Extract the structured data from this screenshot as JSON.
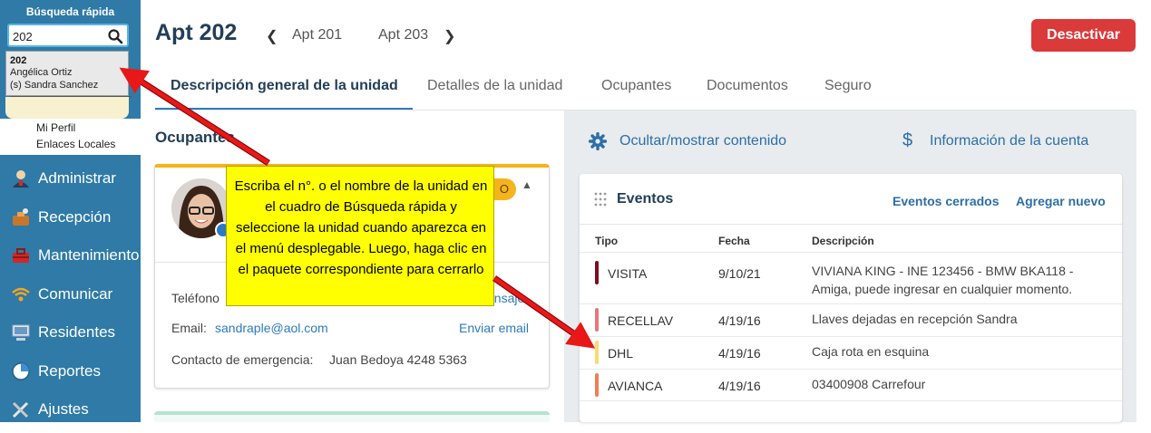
{
  "quick_search": {
    "title": "Búsqueda rápida",
    "value": "202",
    "dropdown": {
      "unit": "202",
      "line1": "Angélica Ortiz",
      "line2": "(s) Sandra Sanchez"
    }
  },
  "submenu": [
    "Mi Perfil",
    "Enlaces Locales"
  ],
  "nav": [
    {
      "label": "Administrar",
      "icon": "admin-icon"
    },
    {
      "label": "Recepción",
      "icon": "reception-icon"
    },
    {
      "label": "Mantenimiento",
      "icon": "toolbox-icon"
    },
    {
      "label": "Comunicar",
      "icon": "wifi-icon"
    },
    {
      "label": "Residentes",
      "icon": "monitor-icon"
    },
    {
      "label": "Reportes",
      "icon": "pie-chart-icon"
    },
    {
      "label": "Ajustes",
      "icon": "tools-icon"
    }
  ],
  "header": {
    "unit": "Apt 202",
    "prev_unit": "Apt 201",
    "next_unit": "Apt 203",
    "deactivate": "Desactivar"
  },
  "tabs": [
    "Descripción general de la unidad",
    "Detalles de la unidad",
    "Ocupantes",
    "Documentos",
    "Seguro"
  ],
  "occupants": {
    "heading": "Ocupantes",
    "tag": "O",
    "phone_label": "Teléfono",
    "message_link": "ensaje",
    "email_label": "Email:",
    "email": "sandraple@aol.com",
    "email_link": "Enviar email",
    "emergency_label": "Contacto de emergencia:",
    "emergency_value": "Juan Bedoya 4248 5363"
  },
  "right_panel": {
    "toggle": "Ocultar/mostrar contenido",
    "account": "Información de la cuenta"
  },
  "events": {
    "title": "Eventos",
    "closed_link": "Eventos cerrados",
    "add_link": "Agregar nuevo",
    "columns": [
      "Tipo",
      "Fecha",
      "Descripción"
    ],
    "rows": [
      {
        "type": "VISITA",
        "date": "9/10/21",
        "desc": "VIVIANA KING - INE 123456 - BMW BKA118 - Amiga, puede ingresar en cualquier momento.",
        "color": "#7a1020"
      },
      {
        "type": "RECELLAV",
        "date": "4/19/16",
        "desc": "Llaves dejadas en recepción Sandra",
        "color": "#e8767c"
      },
      {
        "type": "DHL",
        "date": "4/19/16",
        "desc": "Caja rota en esquina",
        "color": "#f7dc6f"
      },
      {
        "type": "AVIANCA",
        "date": "4/19/16",
        "desc": "03400908 Carrefour",
        "color": "#ee7f55"
      }
    ]
  },
  "callout": {
    "text": "Escriba el n°. o el nombre de la unidad en el cuadro de Búsqueda rápida y seleccione la unidad cuando aparezca en el menú desplegable. Luego, haga clic en el paquete correspondiente para cerrarlo"
  }
}
